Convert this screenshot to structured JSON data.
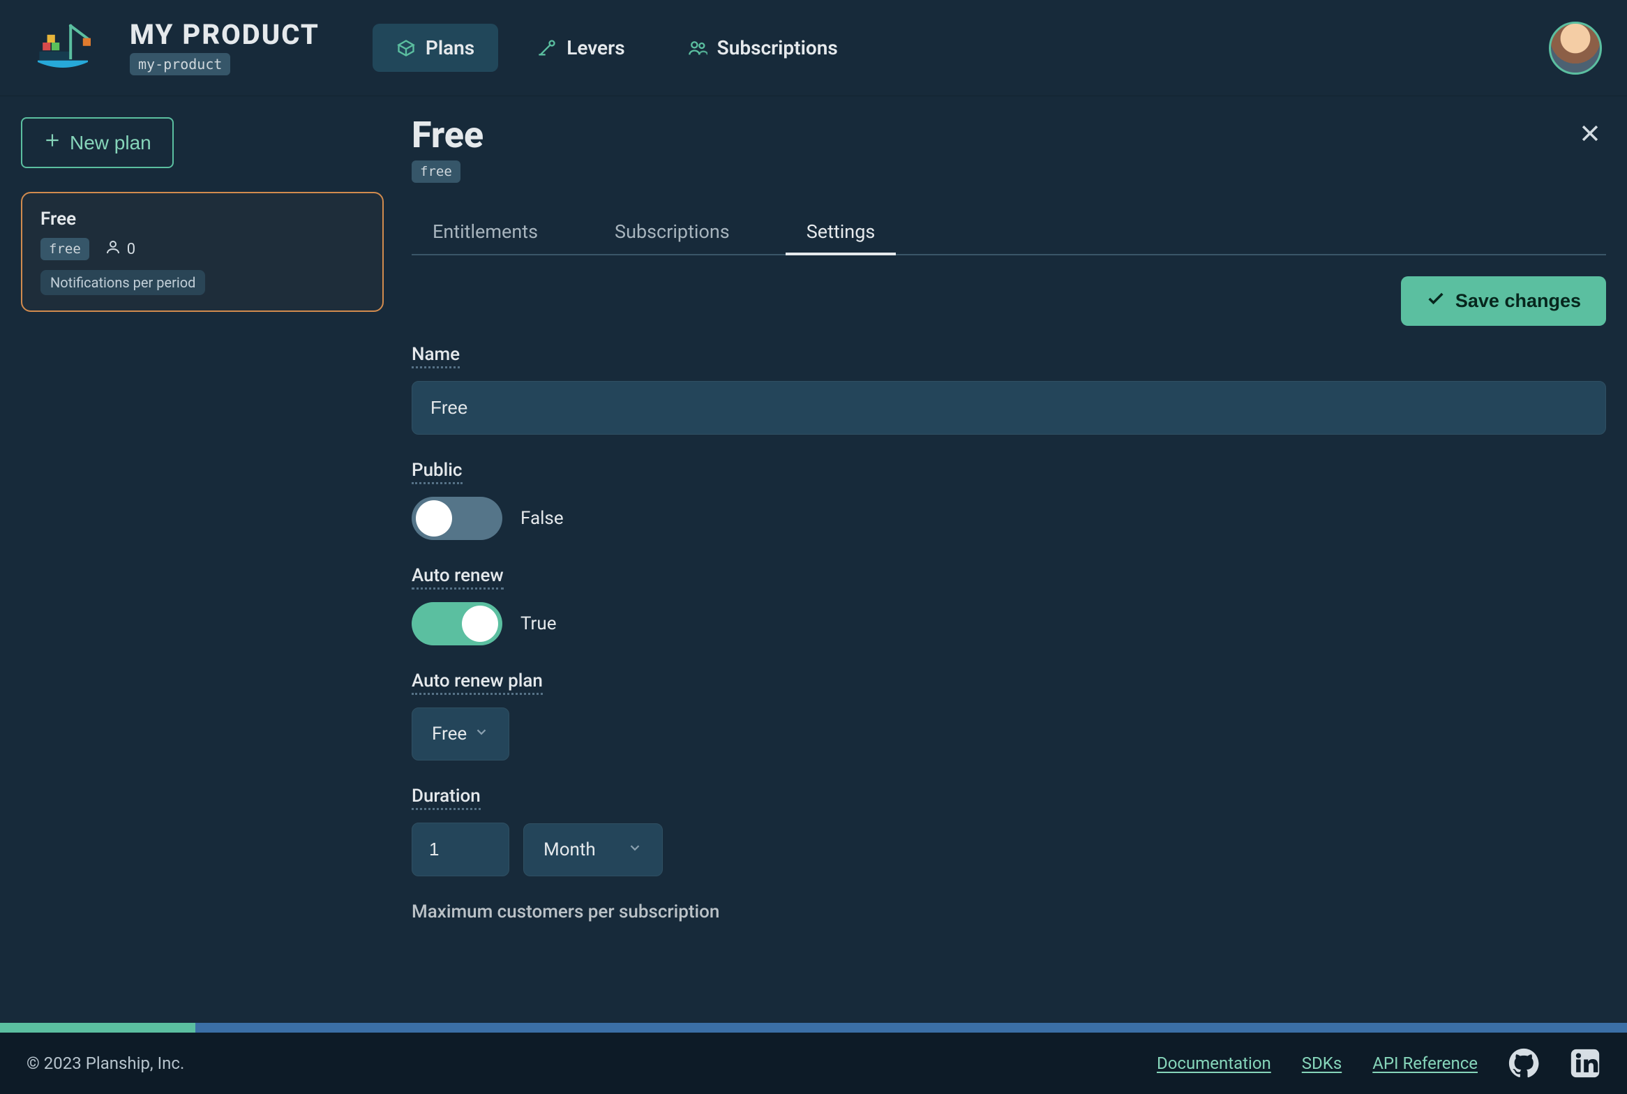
{
  "header": {
    "product_title": "MY PRODUCT",
    "product_slug": "my-product",
    "nav": {
      "plans": "Plans",
      "levers": "Levers",
      "subscriptions": "Subscriptions"
    }
  },
  "sidebar": {
    "new_plan_label": "New plan",
    "card": {
      "title": "Free",
      "slug": "free",
      "user_count": "0",
      "chip": "Notifications per period"
    }
  },
  "main": {
    "title": "Free",
    "slug": "free",
    "tabs": {
      "entitlements": "Entitlements",
      "subscriptions": "Subscriptions",
      "settings": "Settings"
    },
    "save_label": "Save changes",
    "fields": {
      "name_label": "Name",
      "name_value": "Free",
      "public_label": "Public",
      "public_value": "False",
      "auto_renew_label": "Auto renew",
      "auto_renew_value": "True",
      "auto_renew_plan_label": "Auto renew plan",
      "auto_renew_plan_value": "Free",
      "duration_label": "Duration",
      "duration_qty": "1",
      "duration_unit": "Month",
      "max_subscribers_partial": "Maximum customers per subscription"
    }
  },
  "footer": {
    "copyright": "© 2023 Planship, Inc.",
    "documentation": "Documentation",
    "sdks": "SDKs",
    "api_reference": "API Reference"
  }
}
